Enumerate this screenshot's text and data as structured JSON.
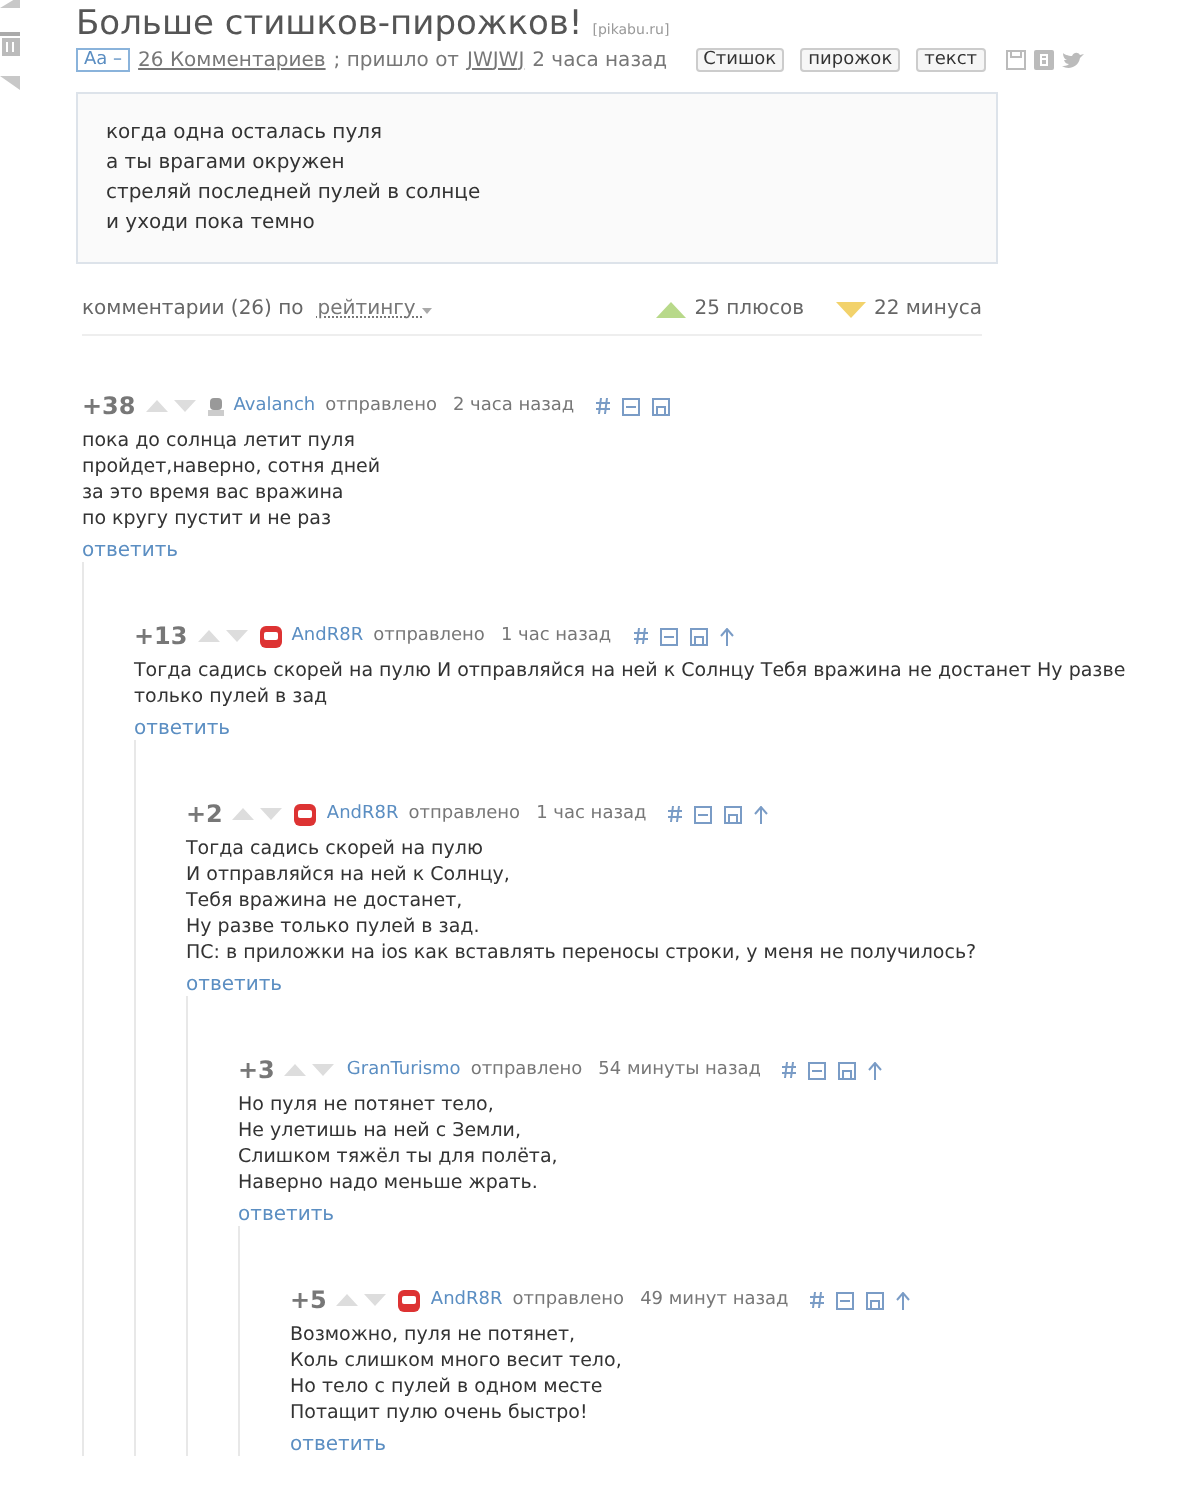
{
  "post": {
    "title": "Больше стишков-пирожков!",
    "source": "[pikabu.ru]",
    "font_toggle": "Aa –",
    "comments_link": "26 Комментариев",
    "from_text": "; пришло от",
    "author": "JWJWJ",
    "time": "2 часа назад",
    "tags": [
      "Стишок",
      "пирожок",
      "текст"
    ],
    "body": "когда одна осталась пуля\nа ты врагами окружен\nстреляй последней пулей в солнце\nи уходи пока темно"
  },
  "comments_header": {
    "label": "комментарии (26) по",
    "sort": "рейтингу",
    "plus": "25 плюсов",
    "minus": "22 минуса"
  },
  "comments": [
    {
      "rating": "+38",
      "kind": "plain",
      "author": "Avalanch",
      "sent": "отправлено",
      "time": "2 часа назад",
      "parent_link": false,
      "body": "пока до солнца летит пуля\nпройдет,наверно, сотня дней\nза это время вас вражина\nпо кругу пустит и не раз",
      "reply": "ответить",
      "children": [
        {
          "rating": "+13",
          "kind": "robot",
          "author": "AndR8R",
          "sent": "отправлено",
          "time": "1 час назад",
          "parent_link": true,
          "body": "Тогда садись скорей на пулю И отправляйся на ней к Солнцу Тебя вражина не достанет Ну разве только пулей в зад",
          "reply": "ответить",
          "children": [
            {
              "rating": "+2",
              "kind": "robot",
              "author": "AndR8R",
              "sent": "отправлено",
              "time": "1 час назад",
              "parent_link": true,
              "body": "Тогда садись скорей на пулю\nИ отправляйся на ней к Солнцу,\nТебя вражина не достанет,\nНу разве только пулей в зад.\nПС: в приложки на ios как вставлять переносы строки, у меня не получилось?",
              "reply": "ответить",
              "children": [
                {
                  "rating": "+3",
                  "author": "GranTurismo",
                  "sent": "отправлено",
                  "time": "54 минуты назад",
                  "parent_link": true,
                  "body": "Но пуля не потянет тело,\nНе улетишь на ней с Земли,\nСлишком тяжёл ты для полёта,\nНаверно надо меньше жрать.",
                  "reply": "ответить",
                  "children": [
                    {
                      "rating": "+5",
                      "kind": "robot",
                      "author": "AndR8R",
                      "sent": "отправлено",
                      "time": "49 минут назад",
                      "parent_link": true,
                      "body": "Возможно, пуля не потянет,\nКоль слишком много весит тело,\nНо тело с пулей в одном месте\nПотащит пулю очень быстро!",
                      "reply": "ответить"
                    }
                  ]
                }
              ]
            }
          ]
        }
      ]
    }
  ]
}
